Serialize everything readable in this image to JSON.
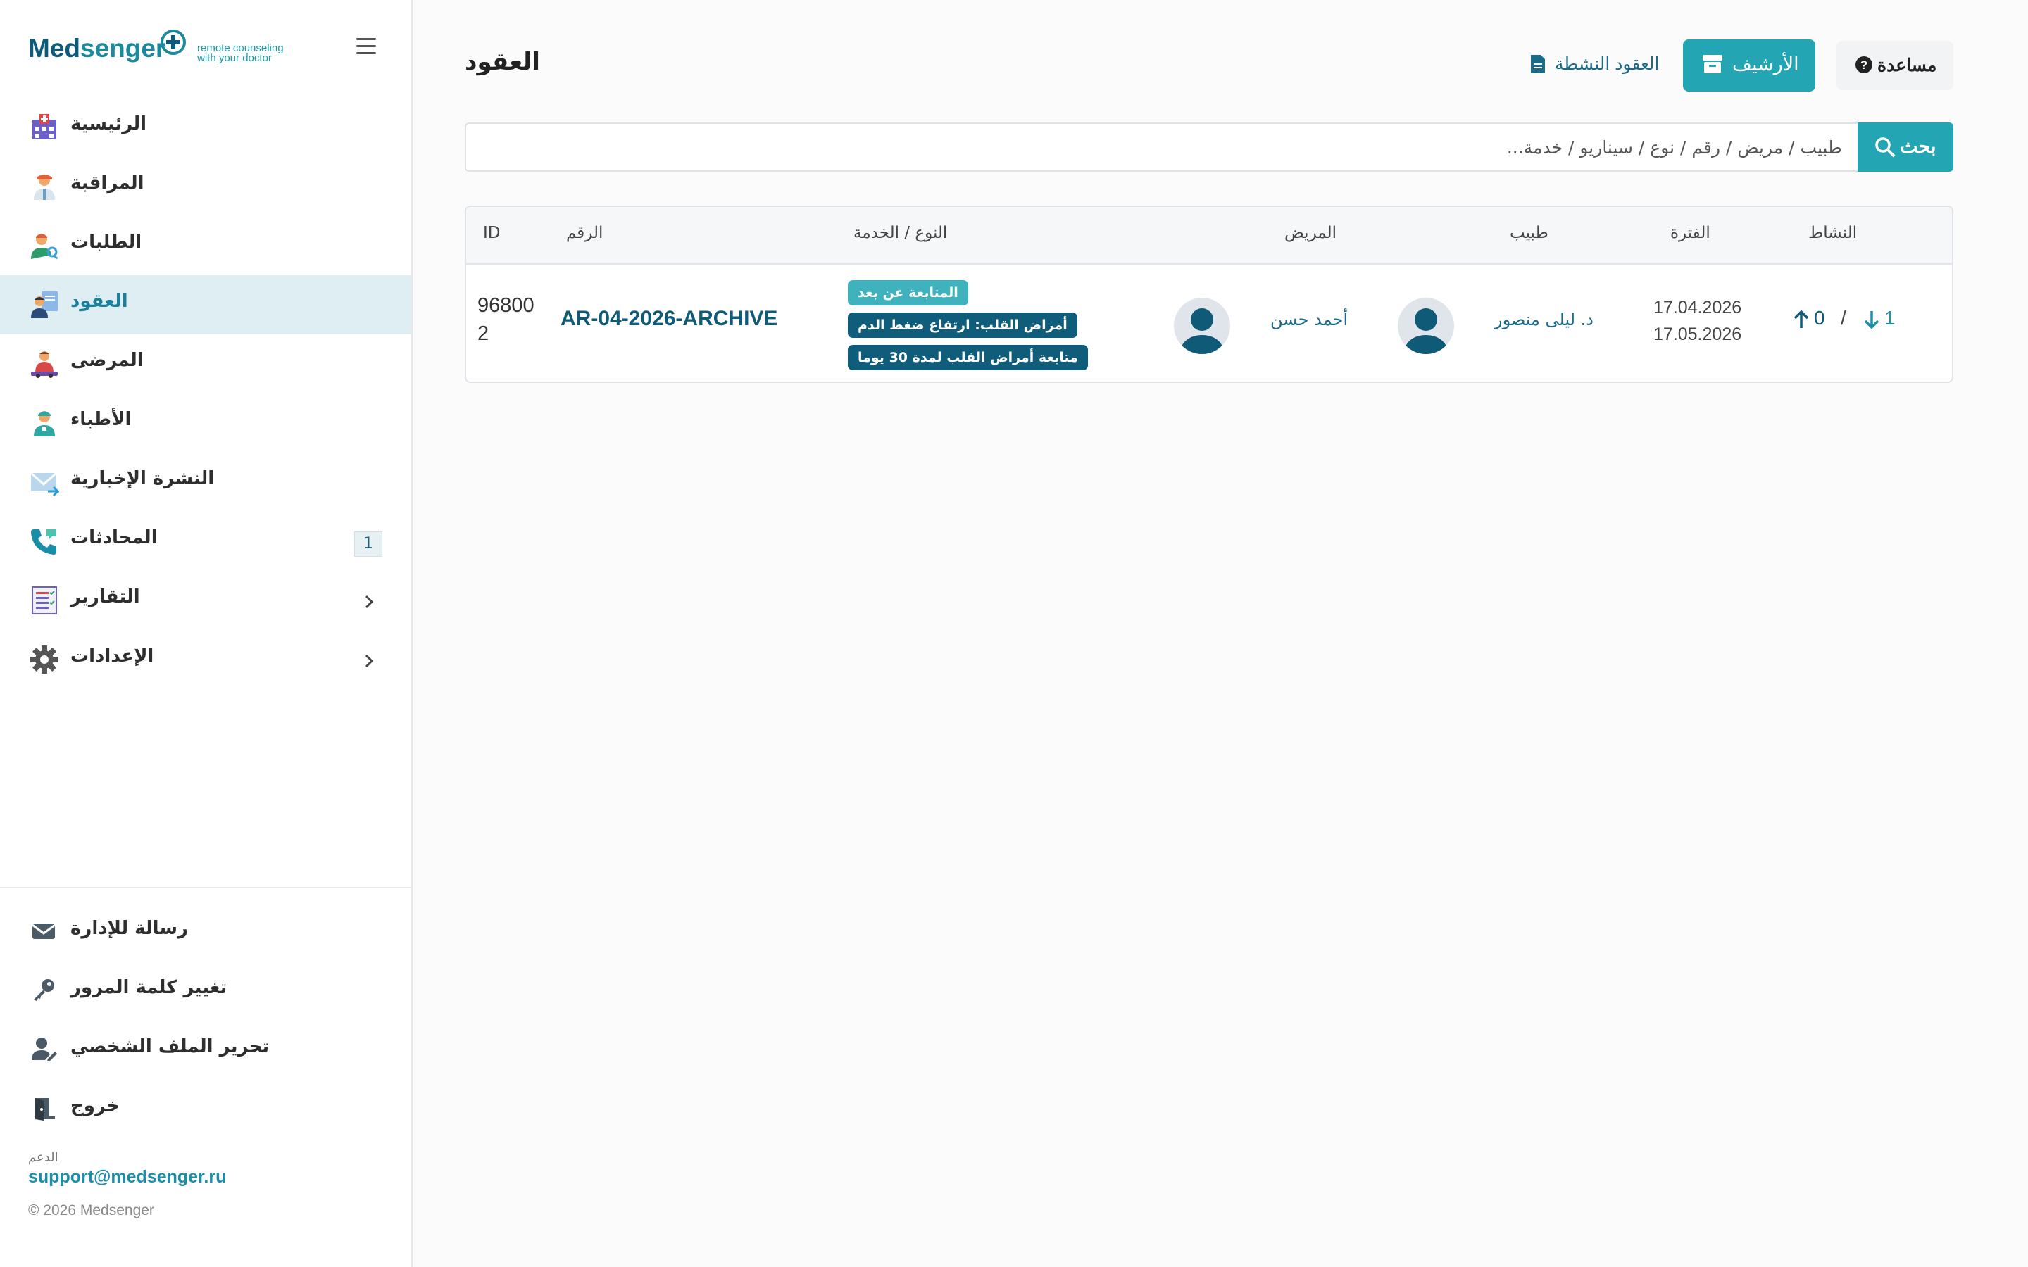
{
  "brand": {
    "name_part1": "Med",
    "name_part2": "senger",
    "tagline_line1": "remote counseling",
    "tagline_line2": "with your doctor",
    "accent_color": "#24a5b3",
    "dark_color": "#0f5a76"
  },
  "sidebar": {
    "items": [
      {
        "label": "الرئيسية",
        "icon": "hospital-icon"
      },
      {
        "label": "المراقبة",
        "icon": "doctor-icon"
      },
      {
        "label": "الطلبات",
        "icon": "user-search-icon"
      },
      {
        "label": "العقود",
        "icon": "contract-icon",
        "active": true
      },
      {
        "label": "المرضى",
        "icon": "patients-icon"
      },
      {
        "label": "الأطباء",
        "icon": "physicians-icon"
      },
      {
        "label": "النشرة الإخبارية",
        "icon": "envelope-icon"
      },
      {
        "label": "المحادثات",
        "icon": "phone-icon",
        "badge": "1"
      },
      {
        "label": "التقارير",
        "icon": "report-icon"
      },
      {
        "label": "الإعدادات",
        "icon": "gear-icon"
      }
    ],
    "footer": [
      {
        "label": "رسالة للإدارة",
        "icon": "mail-icon"
      },
      {
        "label": "تغيير كلمة المرور",
        "icon": "key-icon"
      },
      {
        "label": "تحرير الملف الشخصي",
        "icon": "user-edit-icon"
      },
      {
        "label": "خروج",
        "icon": "exit-door-icon"
      }
    ],
    "support_caption": "الدعم",
    "support_email": "support@medsenger.ru",
    "copyright": "© 2026 Medsenger"
  },
  "header": {
    "title": "العقود",
    "active_contracts_label": "العقود النشطة",
    "archive_label": "الأرشيف",
    "help_label": "مساعدة"
  },
  "search": {
    "placeholder": "طبيب / مريض / رقم / نوع / سيناريو / خدمة...",
    "button_label": "بحث"
  },
  "table": {
    "columns": {
      "id": "ID",
      "number": "الرقم",
      "type": "النوع / الخدمة",
      "patient": "المريض",
      "doctor": "طبيب",
      "period": "الفترة",
      "activity": "النشاط"
    },
    "rows": [
      {
        "id_line1": "96800",
        "id_line2": "2",
        "number": "AR-04-2026-ARCHIVE",
        "tags": [
          "المتابعة عن بعد",
          "أمراض القلب: ارتفاع ضغط الدم",
          "متابعة أمراض القلب لمدة 30 يوما"
        ],
        "patient": "أحمد حسن",
        "doctor": "د. ليلى منصور",
        "period_start": "17.04.2026",
        "period_end": "17.05.2026",
        "activity_in": "1",
        "activity_sep": "/",
        "activity_out": "0"
      }
    ]
  }
}
